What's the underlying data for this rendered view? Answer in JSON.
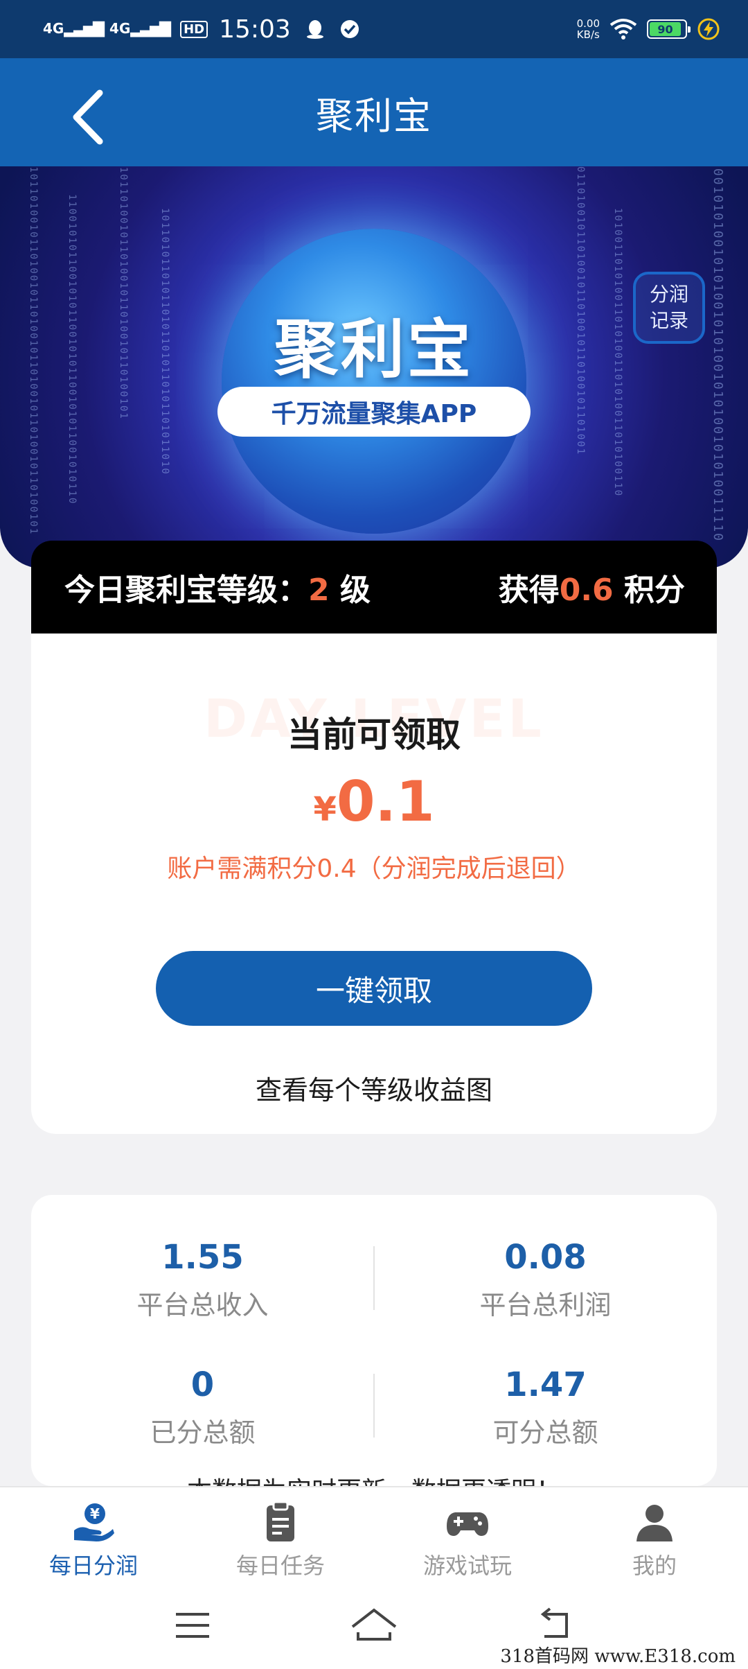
{
  "status_bar": {
    "sim1": "4G",
    "sim2": "4G",
    "hd": "HD",
    "time": "15:03",
    "net_speed_value": "0.00",
    "net_speed_unit": "KB/s",
    "battery": "90"
  },
  "header": {
    "title": "聚利宝"
  },
  "banner": {
    "logo_text": "聚利宝",
    "tagline": "千万流量聚集APP",
    "record_button_line1": "分润",
    "record_button_line2": "记录"
  },
  "level_bar": {
    "prefix": "今日聚利宝等级：",
    "level": "2",
    "level_unit": " 级",
    "gain_prefix": "获得",
    "gain_value": "0.6",
    "gain_unit": " 积分"
  },
  "claim": {
    "watermark": "DAY LEVEL",
    "title": "当前可领取",
    "currency": "¥",
    "amount": "0.1",
    "note": "账户需满积分0.4（分润完成后退回）",
    "button": "一键领取",
    "chart_link": "查看每个等级收益图"
  },
  "stats": {
    "items": [
      {
        "value": "1.55",
        "label": "平台总收入"
      },
      {
        "value": "0.08",
        "label": "平台总利润"
      },
      {
        "value": "0",
        "label": "已分总额"
      },
      {
        "value": "1.47",
        "label": "可分总额"
      }
    ],
    "note": "本数据为实时更新，数据更透明！"
  },
  "tabs": [
    {
      "label": "每日分润"
    },
    {
      "label": "每日任务"
    },
    {
      "label": "游戏试玩"
    },
    {
      "label": "我的"
    }
  ],
  "colors": {
    "brand_blue": "#1464b4",
    "accent_orange": "#f26b43",
    "stat_blue": "#1d5fa8"
  },
  "watermark_text": "318首码网 www.E318.com"
}
